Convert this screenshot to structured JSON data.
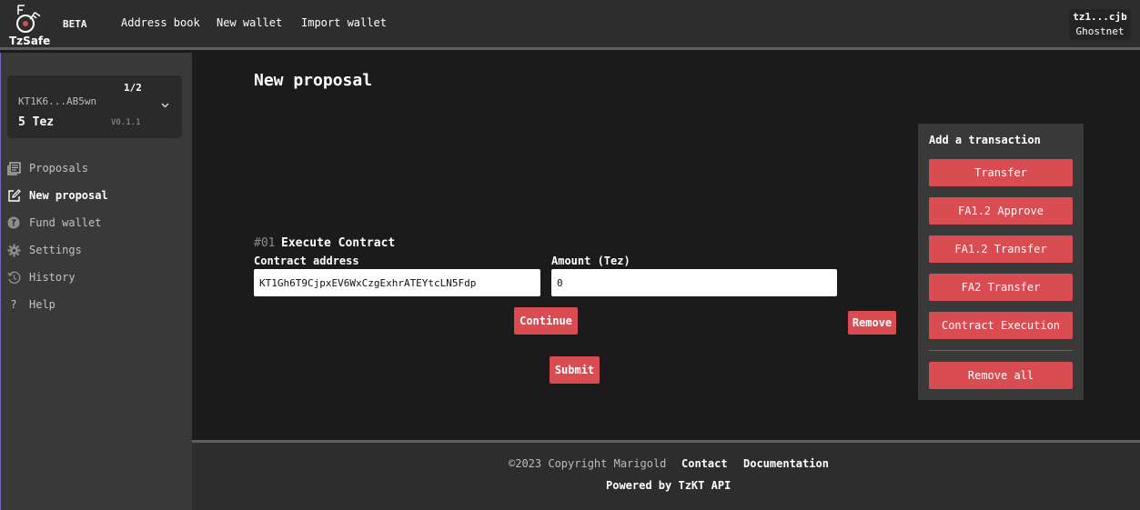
{
  "header": {
    "logo_text": "TzSafe",
    "beta": "BETA",
    "nav": [
      "Address book",
      "New wallet",
      "Import wallet"
    ],
    "account_address": "tz1...cjb",
    "network": "Ghostnet"
  },
  "sidebar": {
    "wallet": {
      "signers": "1/2",
      "address": "KT1K6...AB5wn",
      "balance": "5 Tez",
      "version": "V0.1.1"
    },
    "items": [
      {
        "label": "Proposals",
        "icon": "list-icon"
      },
      {
        "label": "New proposal",
        "icon": "edit-icon",
        "active": true
      },
      {
        "label": "Fund wallet",
        "icon": "tez-icon"
      },
      {
        "label": "Settings",
        "icon": "gear-icon"
      },
      {
        "label": "History",
        "icon": "history-icon"
      },
      {
        "label": "Help",
        "icon": "question-icon"
      }
    ]
  },
  "main": {
    "title": "New proposal",
    "transaction": {
      "index": "#01",
      "type": "Execute Contract",
      "contract_label": "Contract address",
      "contract_value": "KT1Gh6T9CjpxEV6WxCzgExhrATEYtcLN5Fdp",
      "amount_label": "Amount (Tez)",
      "amount_value": "0",
      "continue": "Continue",
      "remove": "Remove"
    },
    "submit": "Submit",
    "add_panel": {
      "title": "Add a transaction",
      "buttons": [
        "Transfer",
        "FA1.2 Approve",
        "FA1.2 Transfer",
        "FA2 Transfer",
        "Contract Execution"
      ],
      "remove_all": "Remove all"
    }
  },
  "footer": {
    "copyright": "©2023 Copyright Marigold",
    "contact": "Contact",
    "documentation": "Documentation",
    "powered": "Powered by TzKT API"
  },
  "colors": {
    "accent": "#d94c52",
    "topbar": "#2d2d2d",
    "sidebar": "#393939",
    "background": "#1b1b1b"
  }
}
